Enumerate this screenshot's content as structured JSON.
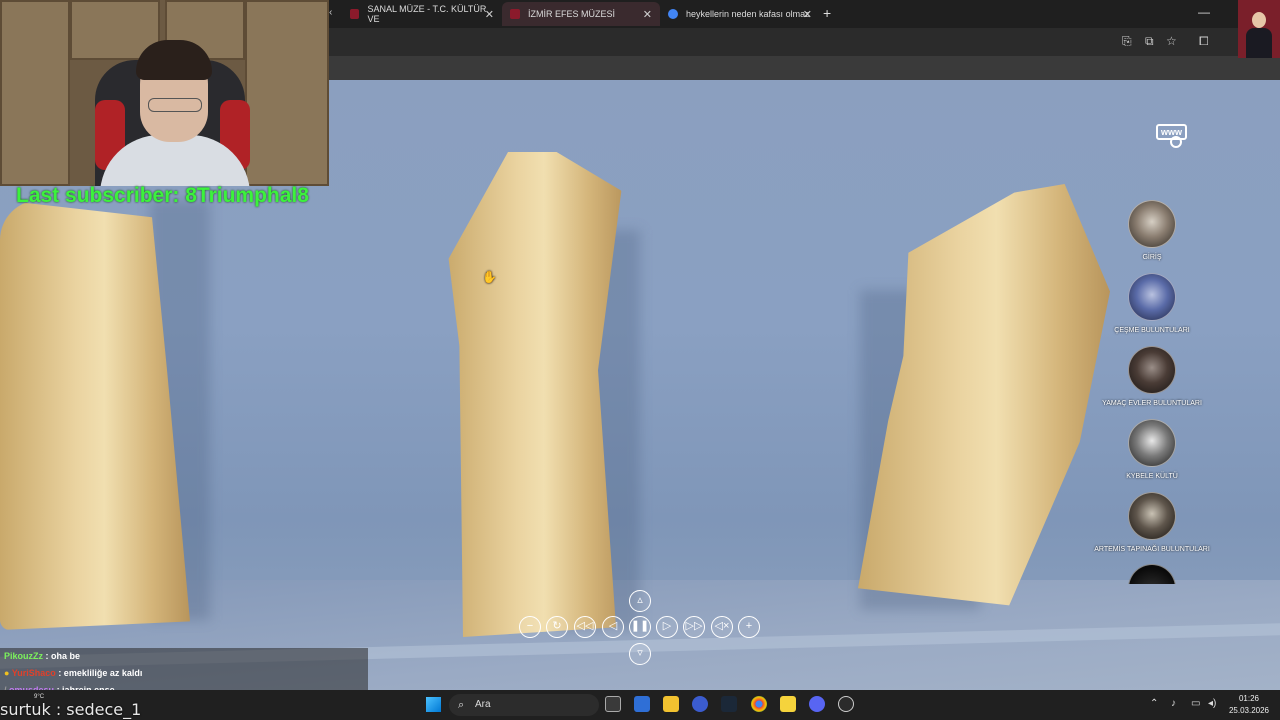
{
  "browser": {
    "tabs": [
      {
        "title": "SANAL MÜZE - T.C. KÜLTÜR VE",
        "active": false,
        "favicon_color": "#8b1a2b"
      },
      {
        "title": "İZMİR EFES MÜZESİ",
        "active": true,
        "favicon_color": "#8b1a2b"
      },
      {
        "title": "heykellerin neden kafası olmaz",
        "active": false,
        "favicon_color": "#4285f4"
      }
    ],
    "new_tab_symbol": "+",
    "scroll_left_symbol": "‹"
  },
  "museum": {
    "locations": [
      {
        "label": "GİRİŞ"
      },
      {
        "label": "ÇEŞME BULUNTULARI"
      },
      {
        "label": "YAMAÇ EVLER BULUNTULARI"
      },
      {
        "label": "KYBELE KÜLTÜ"
      },
      {
        "label": "ARTEMİS TAPINAĞI BULUNTULARI"
      }
    ],
    "www_label": "www"
  },
  "stream": {
    "last_subscriber": "Last subscriber: 8Triumphal8",
    "chat": [
      {
        "user": "PikouzZz",
        "text": ": oha be",
        "user_color": "#7cf25c"
      },
      {
        "user": "YuriShaco",
        "text": ": emekliliğe az kaldı",
        "user_color": "#e0402a"
      },
      {
        "user": "omusdesu",
        "text": ": jahrein ense",
        "user_color": "#c07af0"
      }
    ],
    "bottom_text": "surtuk : sedece_1"
  },
  "taskbar": {
    "search_placeholder": "Ara",
    "time": "01:26",
    "date": "25.03.2026",
    "weather_temp": "9°C"
  }
}
